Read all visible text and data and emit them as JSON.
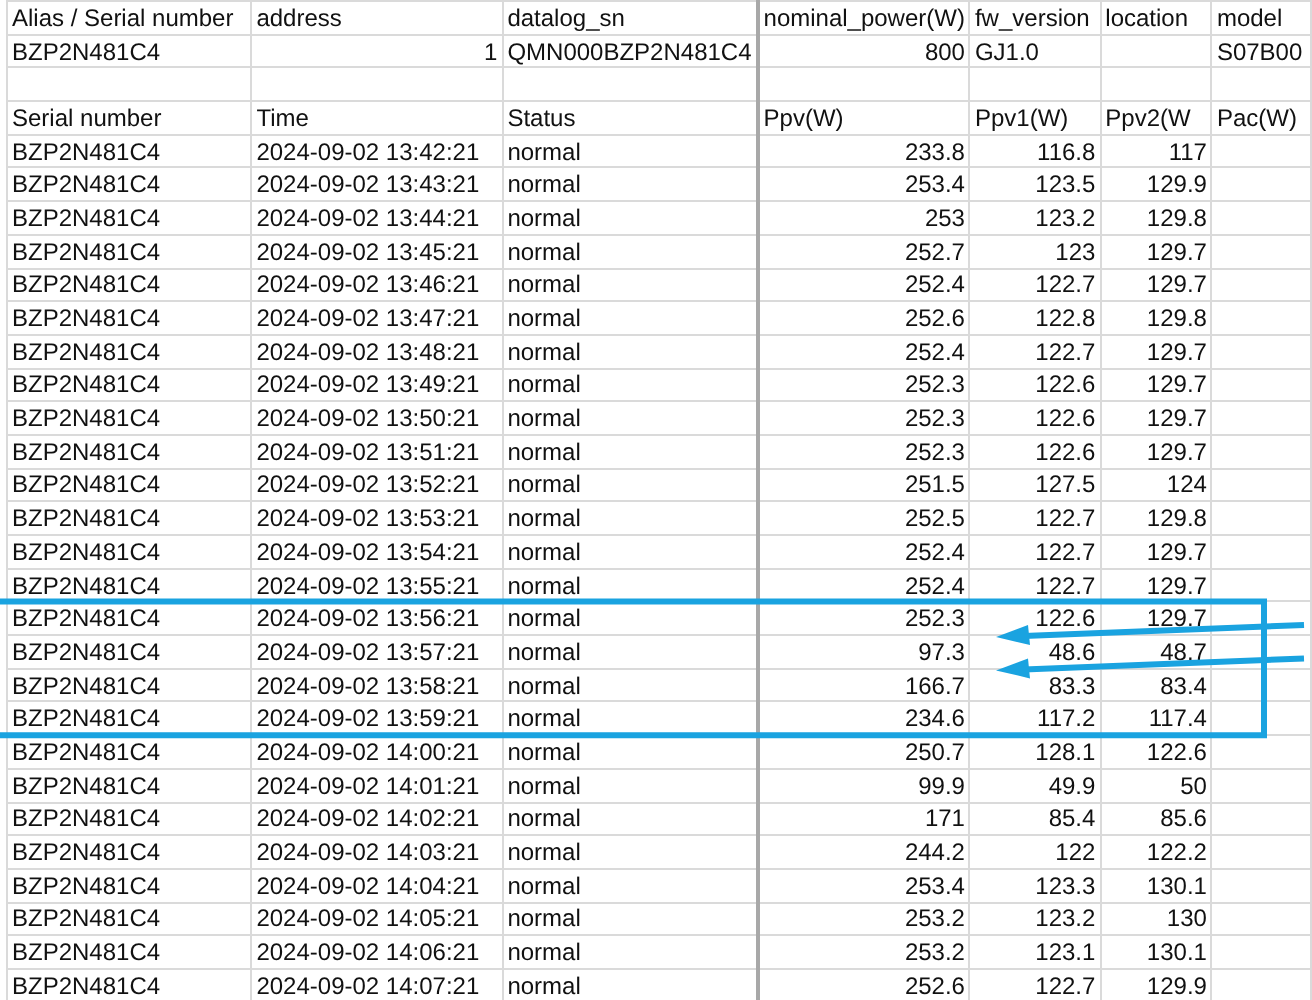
{
  "info_columns": [
    {
      "header": "Alias / Serial number",
      "value": "BZP2N481C4",
      "kind": "text"
    },
    {
      "header": "address",
      "value": "1",
      "kind": "number"
    },
    {
      "header": "datalog_sn",
      "value": "QMN000BZP2N481C4",
      "kind": "text"
    },
    {
      "header": "nominal_power(W)",
      "value": "800",
      "kind": "number"
    },
    {
      "header": "fw_version",
      "value": "GJ1.0",
      "kind": "text"
    },
    {
      "header": "location"
    },
    {
      "header": "model",
      "value": "S07B00",
      "kind": "text"
    }
  ],
  "log_columns": [
    "Serial number",
    "Time",
    "Status",
    "Ppv(W)",
    "Ppv1(W)",
    "Ppv2(W",
    "Pac(W)"
  ],
  "rows": [
    {
      "serial": "BZP2N481C4",
      "time": "2024-09-02 13:42:21",
      "status": "normal",
      "ppv": "233.8",
      "ppv1": "116.8",
      "ppv2": "117"
    },
    {
      "serial": "BZP2N481C4",
      "time": "2024-09-02 13:43:21",
      "status": "normal",
      "ppv": "253.4",
      "ppv1": "123.5",
      "ppv2": "129.9"
    },
    {
      "serial": "BZP2N481C4",
      "time": "2024-09-02 13:44:21",
      "status": "normal",
      "ppv": "253",
      "ppv1": "123.2",
      "ppv2": "129.8"
    },
    {
      "serial": "BZP2N481C4",
      "time": "2024-09-02 13:45:21",
      "status": "normal",
      "ppv": "252.7",
      "ppv1": "123",
      "ppv2": "129.7"
    },
    {
      "serial": "BZP2N481C4",
      "time": "2024-09-02 13:46:21",
      "status": "normal",
      "ppv": "252.4",
      "ppv1": "122.7",
      "ppv2": "129.7"
    },
    {
      "serial": "BZP2N481C4",
      "time": "2024-09-02 13:47:21",
      "status": "normal",
      "ppv": "252.6",
      "ppv1": "122.8",
      "ppv2": "129.8"
    },
    {
      "serial": "BZP2N481C4",
      "time": "2024-09-02 13:48:21",
      "status": "normal",
      "ppv": "252.4",
      "ppv1": "122.7",
      "ppv2": "129.7"
    },
    {
      "serial": "BZP2N481C4",
      "time": "2024-09-02 13:49:21",
      "status": "normal",
      "ppv": "252.3",
      "ppv1": "122.6",
      "ppv2": "129.7"
    },
    {
      "serial": "BZP2N481C4",
      "time": "2024-09-02 13:50:21",
      "status": "normal",
      "ppv": "252.3",
      "ppv1": "122.6",
      "ppv2": "129.7"
    },
    {
      "serial": "BZP2N481C4",
      "time": "2024-09-02 13:51:21",
      "status": "normal",
      "ppv": "252.3",
      "ppv1": "122.6",
      "ppv2": "129.7"
    },
    {
      "serial": "BZP2N481C4",
      "time": "2024-09-02 13:52:21",
      "status": "normal",
      "ppv": "251.5",
      "ppv1": "127.5",
      "ppv2": "124"
    },
    {
      "serial": "BZP2N481C4",
      "time": "2024-09-02 13:53:21",
      "status": "normal",
      "ppv": "252.5",
      "ppv1": "122.7",
      "ppv2": "129.8"
    },
    {
      "serial": "BZP2N481C4",
      "time": "2024-09-02 13:54:21",
      "status": "normal",
      "ppv": "252.4",
      "ppv1": "122.7",
      "ppv2": "129.7"
    },
    {
      "serial": "BZP2N481C4",
      "time": "2024-09-02 13:55:21",
      "status": "normal",
      "ppv": "252.4",
      "ppv1": "122.7",
      "ppv2": "129.7"
    },
    {
      "serial": "BZP2N481C4",
      "time": "2024-09-02 13:56:21",
      "status": "normal",
      "ppv": "252.3",
      "ppv1": "122.6",
      "ppv2": "129.7"
    },
    {
      "serial": "BZP2N481C4",
      "time": "2024-09-02 13:57:21",
      "status": "normal",
      "ppv": "97.3",
      "ppv1": "48.6",
      "ppv2": "48.7"
    },
    {
      "serial": "BZP2N481C4",
      "time": "2024-09-02 13:58:21",
      "status": "normal",
      "ppv": "166.7",
      "ppv1": "83.3",
      "ppv2": "83.4"
    },
    {
      "serial": "BZP2N481C4",
      "time": "2024-09-02 13:59:21",
      "status": "normal",
      "ppv": "234.6",
      "ppv1": "117.2",
      "ppv2": "117.4"
    },
    {
      "serial": "BZP2N481C4",
      "time": "2024-09-02 14:00:21",
      "status": "normal",
      "ppv": "250.7",
      "ppv1": "128.1",
      "ppv2": "122.6"
    },
    {
      "serial": "BZP2N481C4",
      "time": "2024-09-02 14:01:21",
      "status": "normal",
      "ppv": "99.9",
      "ppv1": "49.9",
      "ppv2": "50"
    },
    {
      "serial": "BZP2N481C4",
      "time": "2024-09-02 14:02:21",
      "status": "normal",
      "ppv": "171",
      "ppv1": "85.4",
      "ppv2": "85.6"
    },
    {
      "serial": "BZP2N481C4",
      "time": "2024-09-02 14:03:21",
      "status": "normal",
      "ppv": "244.2",
      "ppv1": "122",
      "ppv2": "122.2"
    },
    {
      "serial": "BZP2N481C4",
      "time": "2024-09-02 14:04:21",
      "status": "normal",
      "ppv": "253.4",
      "ppv1": "123.3",
      "ppv2": "130.1"
    },
    {
      "serial": "BZP2N481C4",
      "time": "2024-09-02 14:05:21",
      "status": "normal",
      "ppv": "253.2",
      "ppv1": "123.2",
      "ppv2": "130"
    },
    {
      "serial": "BZP2N481C4",
      "time": "2024-09-02 14:06:21",
      "status": "normal",
      "ppv": "253.2",
      "ppv1": "123.1",
      "ppv2": "130.1"
    },
    {
      "serial": "BZP2N481C4",
      "time": "2024-09-02 14:07:21",
      "status": "normal",
      "ppv": "252.6",
      "ppv1": "122.7",
      "ppv2": "129.9"
    }
  ]
}
